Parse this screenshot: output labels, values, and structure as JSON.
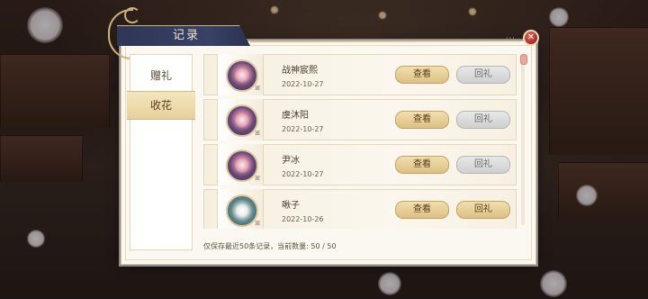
{
  "dialog": {
    "title": "记录",
    "close_icon": "close-icon",
    "accent_color": "#c9b27e"
  },
  "sidebar": {
    "tabs": [
      {
        "label": "赠礼",
        "active": false
      },
      {
        "label": "收花",
        "active": true
      }
    ]
  },
  "records": [
    {
      "name": "战神宸熙",
      "date": "2022-10-27",
      "avatar": "pink-flower-bouquet",
      "view_label": "查看",
      "return_label": "回礼",
      "return_enabled": false
    },
    {
      "name": "虞沐阳",
      "date": "2022-10-27",
      "avatar": "pink-flower-bouquet",
      "view_label": "查看",
      "return_label": "回礼",
      "return_enabled": false
    },
    {
      "name": "尹冰",
      "date": "2022-10-27",
      "avatar": "pink-flower-bouquet",
      "view_label": "查看",
      "return_label": "回礼",
      "return_enabled": false
    },
    {
      "name": "啾子",
      "date": "2022-10-26",
      "avatar": "white-flower-bouquet",
      "view_label": "查看",
      "return_label": "回礼",
      "return_enabled": true
    }
  ],
  "footer": {
    "text": "仅保存最近50条记录，当前数量: 50 / 50"
  }
}
